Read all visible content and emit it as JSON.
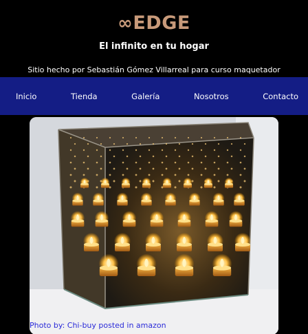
{
  "header": {
    "logo_symbol": "∞",
    "logo_text": "EDGE",
    "tagline": "El infinito en tu hogar",
    "credit": "Sitio hecho por Sebastián Gómez Villarreal para curso maquetador"
  },
  "nav": {
    "items": [
      {
        "label": "Inicio"
      },
      {
        "label": "Tienda"
      },
      {
        "label": "Galería"
      },
      {
        "label": "Nosotros"
      },
      {
        "label": "Contacto"
      }
    ]
  },
  "photo": {
    "caption": "Photo by: Chi-buy posted in amazon"
  },
  "colors": {
    "logo": "#c89a7a",
    "nav_bg": "#141d85",
    "caption": "#2a2ad8"
  }
}
